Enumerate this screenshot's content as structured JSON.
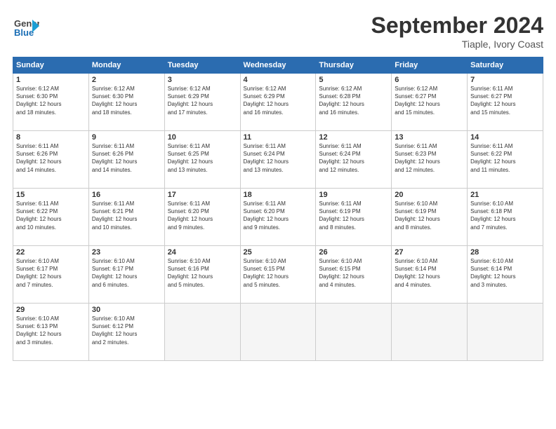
{
  "header": {
    "logo_general": "General",
    "logo_blue": "Blue",
    "title": "September 2024",
    "location": "Tiaple, Ivory Coast"
  },
  "weekdays": [
    "Sunday",
    "Monday",
    "Tuesday",
    "Wednesday",
    "Thursday",
    "Friday",
    "Saturday"
  ],
  "weeks": [
    [
      {
        "day": "1",
        "info": "Sunrise: 6:12 AM\nSunset: 6:30 PM\nDaylight: 12 hours\nand 18 minutes."
      },
      {
        "day": "2",
        "info": "Sunrise: 6:12 AM\nSunset: 6:30 PM\nDaylight: 12 hours\nand 18 minutes."
      },
      {
        "day": "3",
        "info": "Sunrise: 6:12 AM\nSunset: 6:29 PM\nDaylight: 12 hours\nand 17 minutes."
      },
      {
        "day": "4",
        "info": "Sunrise: 6:12 AM\nSunset: 6:29 PM\nDaylight: 12 hours\nand 16 minutes."
      },
      {
        "day": "5",
        "info": "Sunrise: 6:12 AM\nSunset: 6:28 PM\nDaylight: 12 hours\nand 16 minutes."
      },
      {
        "day": "6",
        "info": "Sunrise: 6:12 AM\nSunset: 6:27 PM\nDaylight: 12 hours\nand 15 minutes."
      },
      {
        "day": "7",
        "info": "Sunrise: 6:11 AM\nSunset: 6:27 PM\nDaylight: 12 hours\nand 15 minutes."
      }
    ],
    [
      {
        "day": "8",
        "info": "Sunrise: 6:11 AM\nSunset: 6:26 PM\nDaylight: 12 hours\nand 14 minutes."
      },
      {
        "day": "9",
        "info": "Sunrise: 6:11 AM\nSunset: 6:26 PM\nDaylight: 12 hours\nand 14 minutes."
      },
      {
        "day": "10",
        "info": "Sunrise: 6:11 AM\nSunset: 6:25 PM\nDaylight: 12 hours\nand 13 minutes."
      },
      {
        "day": "11",
        "info": "Sunrise: 6:11 AM\nSunset: 6:24 PM\nDaylight: 12 hours\nand 13 minutes."
      },
      {
        "day": "12",
        "info": "Sunrise: 6:11 AM\nSunset: 6:24 PM\nDaylight: 12 hours\nand 12 minutes."
      },
      {
        "day": "13",
        "info": "Sunrise: 6:11 AM\nSunset: 6:23 PM\nDaylight: 12 hours\nand 12 minutes."
      },
      {
        "day": "14",
        "info": "Sunrise: 6:11 AM\nSunset: 6:22 PM\nDaylight: 12 hours\nand 11 minutes."
      }
    ],
    [
      {
        "day": "15",
        "info": "Sunrise: 6:11 AM\nSunset: 6:22 PM\nDaylight: 12 hours\nand 10 minutes."
      },
      {
        "day": "16",
        "info": "Sunrise: 6:11 AM\nSunset: 6:21 PM\nDaylight: 12 hours\nand 10 minutes."
      },
      {
        "day": "17",
        "info": "Sunrise: 6:11 AM\nSunset: 6:20 PM\nDaylight: 12 hours\nand 9 minutes."
      },
      {
        "day": "18",
        "info": "Sunrise: 6:11 AM\nSunset: 6:20 PM\nDaylight: 12 hours\nand 9 minutes."
      },
      {
        "day": "19",
        "info": "Sunrise: 6:11 AM\nSunset: 6:19 PM\nDaylight: 12 hours\nand 8 minutes."
      },
      {
        "day": "20",
        "info": "Sunrise: 6:10 AM\nSunset: 6:19 PM\nDaylight: 12 hours\nand 8 minutes."
      },
      {
        "day": "21",
        "info": "Sunrise: 6:10 AM\nSunset: 6:18 PM\nDaylight: 12 hours\nand 7 minutes."
      }
    ],
    [
      {
        "day": "22",
        "info": "Sunrise: 6:10 AM\nSunset: 6:17 PM\nDaylight: 12 hours\nand 7 minutes."
      },
      {
        "day": "23",
        "info": "Sunrise: 6:10 AM\nSunset: 6:17 PM\nDaylight: 12 hours\nand 6 minutes."
      },
      {
        "day": "24",
        "info": "Sunrise: 6:10 AM\nSunset: 6:16 PM\nDaylight: 12 hours\nand 5 minutes."
      },
      {
        "day": "25",
        "info": "Sunrise: 6:10 AM\nSunset: 6:15 PM\nDaylight: 12 hours\nand 5 minutes."
      },
      {
        "day": "26",
        "info": "Sunrise: 6:10 AM\nSunset: 6:15 PM\nDaylight: 12 hours\nand 4 minutes."
      },
      {
        "day": "27",
        "info": "Sunrise: 6:10 AM\nSunset: 6:14 PM\nDaylight: 12 hours\nand 4 minutes."
      },
      {
        "day": "28",
        "info": "Sunrise: 6:10 AM\nSunset: 6:14 PM\nDaylight: 12 hours\nand 3 minutes."
      }
    ],
    [
      {
        "day": "29",
        "info": "Sunrise: 6:10 AM\nSunset: 6:13 PM\nDaylight: 12 hours\nand 3 minutes."
      },
      {
        "day": "30",
        "info": "Sunrise: 6:10 AM\nSunset: 6:12 PM\nDaylight: 12 hours\nand 2 minutes."
      },
      {
        "day": "",
        "info": ""
      },
      {
        "day": "",
        "info": ""
      },
      {
        "day": "",
        "info": ""
      },
      {
        "day": "",
        "info": ""
      },
      {
        "day": "",
        "info": ""
      }
    ]
  ]
}
